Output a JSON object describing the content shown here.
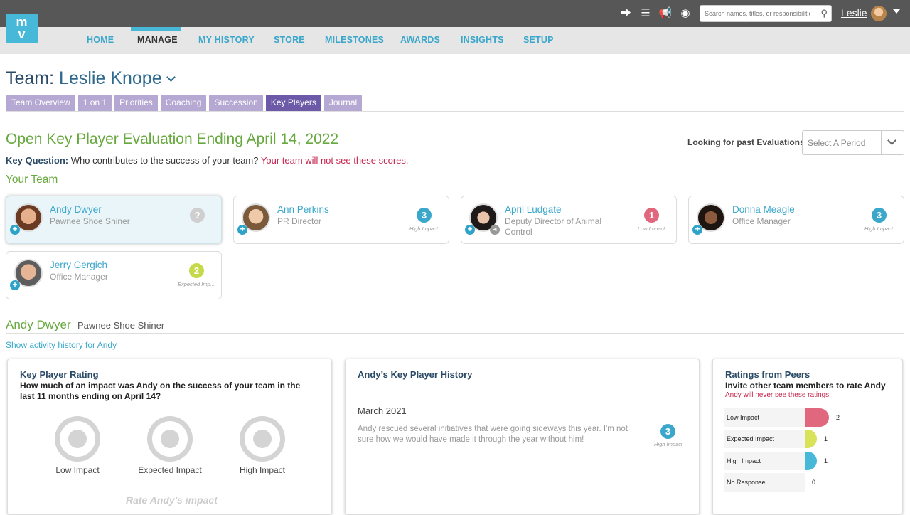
{
  "search": {
    "placeholder": "Search names, titles, or responsibilities"
  },
  "user": {
    "name": "Leslie"
  },
  "logo": {
    "line1": "m",
    "line2": "v"
  },
  "nav": {
    "items": [
      "HOME",
      "MANAGE",
      "MY HISTORY",
      "STORE",
      "MILESTONES",
      "AWARDS",
      "INSIGHTS",
      "SETUP"
    ],
    "active": "MANAGE"
  },
  "team": {
    "label": "Team:",
    "name": "Leslie Knope"
  },
  "tabs": [
    "Team Overview",
    "1 on 1",
    "Priorities",
    "Coaching",
    "Succession",
    "Key Players",
    "Journal"
  ],
  "evaluation": {
    "title": "Open Key Player Evaluation Ending April 14, 2022",
    "key_question_label": "Key Question:",
    "key_question": "Who contributes to the success of your team?",
    "key_question_warning": "Your team will not see these scores.",
    "past_label": "Looking for past Evaluations?",
    "period_placeholder": "Select A Period"
  },
  "your_team_label": "Your Team",
  "members": [
    {
      "name": "Andy Dwyer",
      "title": "Pawnee Shoe Shiner",
      "score": "?",
      "impact": "",
      "color": "#cfcfcf"
    },
    {
      "name": "Ann Perkins",
      "title": "PR Director",
      "score": "3",
      "impact": "High Impact",
      "color": "#3aa7cb"
    },
    {
      "name": "April Ludgate",
      "title": "Deputy Director of Animal Control",
      "score": "1",
      "impact": "Low Impact",
      "color": "#e0677e"
    },
    {
      "name": "Donna Meagle",
      "title": "Office Manager",
      "score": "3",
      "impact": "High Impact",
      "color": "#3aa7cb"
    },
    {
      "name": "Jerry Gergich",
      "title": "Office Manager",
      "score": "2",
      "impact": "Expected Imp...",
      "color": "#c6d94a"
    }
  ],
  "selected": {
    "name": "Andy Dwyer",
    "title": "Pawnee Shoe Shiner",
    "history_link": "Show activity history for Andy"
  },
  "rating_panel": {
    "title": "Key Player Rating",
    "question": "How much of an impact was Andy on the success of your team in the last 11 months ending on April 14?",
    "options": [
      "Low Impact",
      "Expected Impact",
      "High Impact"
    ],
    "cta": "Rate Andy's impact"
  },
  "history_panel": {
    "title": "Andy’s Key Player History",
    "month": "March 2021",
    "text": "Andy rescued several initiatives that were going sideways this year. I'm not sure how we would have made it through the year without him!",
    "score": "3",
    "impact": "High Impact"
  },
  "peers_panel": {
    "title": "Ratings from Peers",
    "subtitle": "Invite other team members to rate Andy",
    "warning": "Andy will never see these ratings",
    "rows": [
      {
        "label": "Low Impact",
        "count": 2,
        "color": "#e0677e"
      },
      {
        "label": "Expected Impact",
        "count": 1,
        "color": "#d9e35a"
      },
      {
        "label": "High Impact",
        "count": 1,
        "color": "#47b8d8"
      },
      {
        "label": "No Response",
        "count": 0,
        "color": "#cccccc"
      }
    ]
  }
}
